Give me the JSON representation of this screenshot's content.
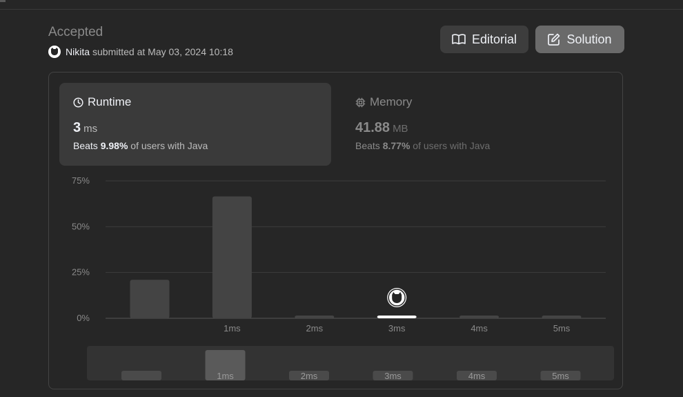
{
  "submission": {
    "status": "Accepted",
    "user": "Nikita",
    "submitted_text": "submitted at May 03, 2024 10:18"
  },
  "buttons": {
    "editorial": "Editorial",
    "solution": "Solution"
  },
  "runtime": {
    "label": "Runtime",
    "value": "3",
    "unit": "ms",
    "beats_prefix": "Beats",
    "beats_pct": "9.98%",
    "beats_suffix": "of users with Java"
  },
  "memory": {
    "label": "Memory",
    "value": "41.88",
    "unit": "MB",
    "beats_prefix": "Beats",
    "beats_pct": "8.77%",
    "beats_suffix": "of users with Java"
  },
  "icons": {
    "editorial": "book-icon",
    "solution": "edit-icon",
    "runtime": "clock-icon",
    "memory": "chip-icon",
    "avatar": "user-avatar-icon"
  },
  "colors": {
    "background": "#262626",
    "bar": "#444444",
    "bar_selected": "#ffffff",
    "nav_bar": "#4a4a4a",
    "nav_bar_highlight": "#5a5a5a"
  },
  "chart_data": {
    "type": "bar",
    "categories": [
      "",
      "1ms",
      "2ms",
      "3ms",
      "4ms",
      "5ms"
    ],
    "values": [
      21,
      66.5,
      1.5,
      1.5,
      1.5,
      1.5
    ],
    "selected_index": 3,
    "ylim": [
      0,
      75
    ],
    "yticks": [
      "75%",
      "50%",
      "25%",
      "0%"
    ],
    "ytick_values": [
      75,
      50,
      25,
      0
    ],
    "grid": true,
    "navigator": {
      "labels": [
        "",
        "1ms",
        "2ms",
        "3ms",
        "4ms",
        "5ms"
      ],
      "highlight_index": 1
    }
  }
}
